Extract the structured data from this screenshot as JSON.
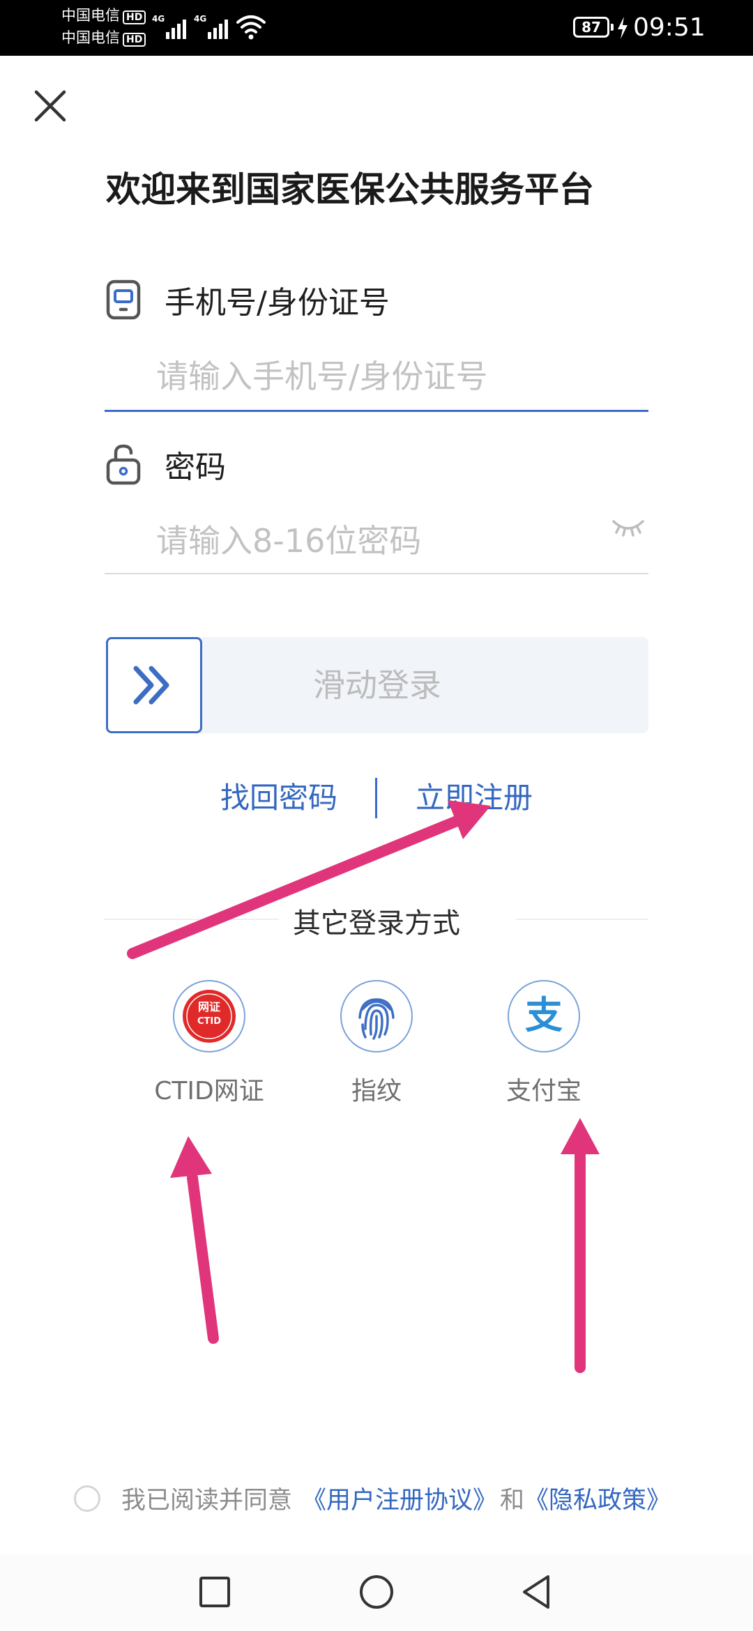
{
  "status_bar": {
    "carrier1": "中国电信",
    "carrier2": "中国电信",
    "hd": "HD",
    "network1": "4G",
    "network2": "4G",
    "battery": "87",
    "time": "09:51"
  },
  "header": {
    "title": "欢迎来到国家医保公共服务平台"
  },
  "form": {
    "account_label": "手机号/身份证号",
    "account_placeholder": "请输入手机号/身份证号",
    "password_label": "密码",
    "password_placeholder": "请输入8-16位密码"
  },
  "slider": {
    "label": "滑动登录"
  },
  "links": {
    "forgot_password": "找回密码",
    "register": "立即注册"
  },
  "other_login": {
    "title": "其它登录方式",
    "methods": [
      {
        "label": "CTID网证",
        "icon": "ctid-icon",
        "badge_top": "网证",
        "badge_bottom": "CTID"
      },
      {
        "label": "指纹",
        "icon": "fingerprint-icon"
      },
      {
        "label": "支付宝",
        "icon": "alipay-icon",
        "glyph": "支"
      }
    ]
  },
  "agreement": {
    "prefix": "我已阅读并同意",
    "user_agreement": "《用户注册协议》",
    "and": "和",
    "privacy": "《隐私政策》"
  },
  "colors": {
    "accent": "#3367c0",
    "annotation_arrow": "#e0357a"
  }
}
